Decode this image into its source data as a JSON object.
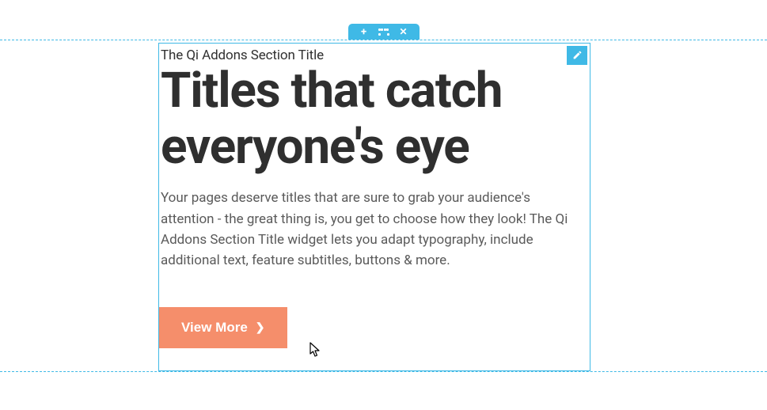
{
  "section": {
    "subtitle": "The Qi Addons Section Title",
    "title": "Titles that catch everyone's eye",
    "description": "Your pages deserve titles that are sure to grab your audience's attention - the great thing is, you get to choose how they look! The Qi Addons Section Title widget lets you adapt typography, include additional text, feature subtitles, buttons & more.",
    "button_label": "View More"
  },
  "colors": {
    "accent": "#3fb9e6",
    "button_bg": "#f58e6b"
  }
}
